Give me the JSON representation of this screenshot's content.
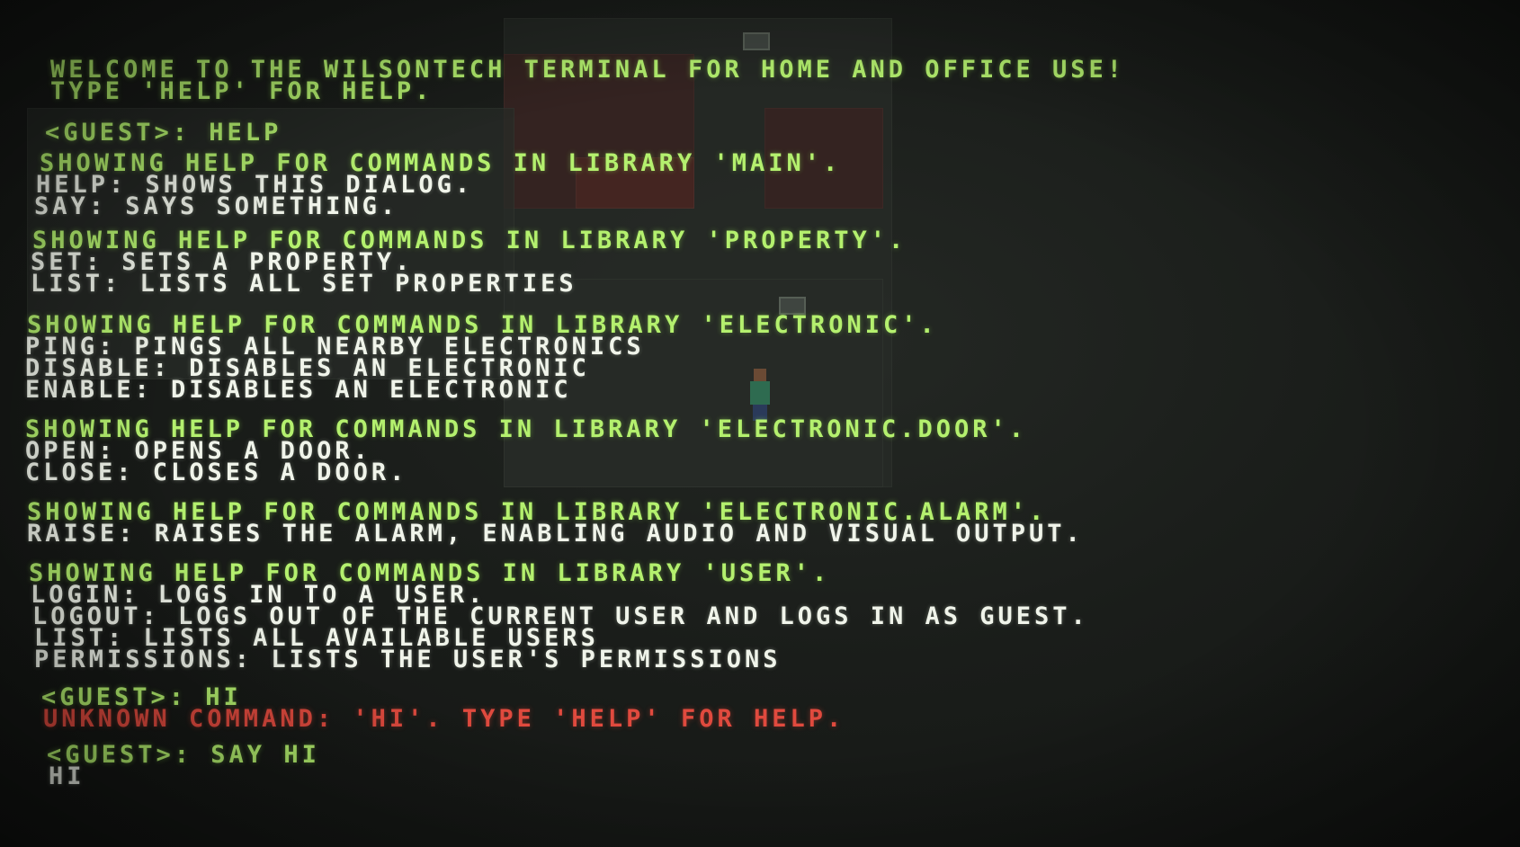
{
  "terminal": {
    "welcome": "WELCOME TO THE WILSONTECH TERMINAL FOR HOME AND OFFICE USE!",
    "help_hint": "TYPE 'HELP' FOR HELP.",
    "cmd1": "<GUEST>: HELP",
    "sections": [
      {
        "header": "SHOWING HELP FOR COMMANDS IN LIBRARY 'MAIN'.",
        "lines": [
          "HELP: SHOWS THIS DIALOG.",
          "SAY: SAYS SOMETHING."
        ]
      },
      {
        "header": "SHOWING HELP FOR COMMANDS IN LIBRARY 'PROPERTY'.",
        "lines": [
          "SET: SETS A PROPERTY.",
          "LIST: LISTS ALL SET PROPERTIES"
        ]
      },
      {
        "header": "SHOWING HELP FOR COMMANDS IN LIBRARY 'ELECTRONIC'.",
        "lines": [
          "PING: PINGS ALL NEARBY ELECTRONICS",
          "DISABLE: DISABLES AN ELECTRONIC",
          "ENABLE: DISABLES AN ELECTRONIC"
        ]
      },
      {
        "header": "SHOWING HELP FOR COMMANDS IN LIBRARY 'ELECTRONIC.DOOR'.",
        "lines": [
          "OPEN: OPENS A DOOR.",
          "CLOSE: CLOSES A DOOR."
        ]
      },
      {
        "header": "SHOWING HELP FOR COMMANDS IN LIBRARY 'ELECTRONIC.ALARM'.",
        "lines": [
          "RAISE: RAISES THE ALARM, ENABLING AUDIO AND VISUAL OUTPUT."
        ]
      },
      {
        "header": "SHOWING HELP FOR COMMANDS IN LIBRARY 'USER'.",
        "lines": [
          "LOGIN: LOGS IN TO A USER.",
          "LOGOUT: LOGS OUT OF THE CURRENT USER AND LOGS IN AS GUEST.",
          "LIST: LISTS ALL AVAILABLE USERS",
          "PERMISSIONS: LISTS THE USER'S PERMISSIONS"
        ]
      }
    ],
    "cmd2": "<GUEST>: HI",
    "error": "UNKNOWN COMMAND: 'HI'. TYPE 'HELP' FOR HELP.",
    "cmd3": "<GUEST>: SAY HI",
    "output": "HI"
  },
  "colors": {
    "prompt_green": "#b4f06e",
    "output_white": "#f0f4ea",
    "error_red": "#e04a3e",
    "background": "#141614"
  }
}
